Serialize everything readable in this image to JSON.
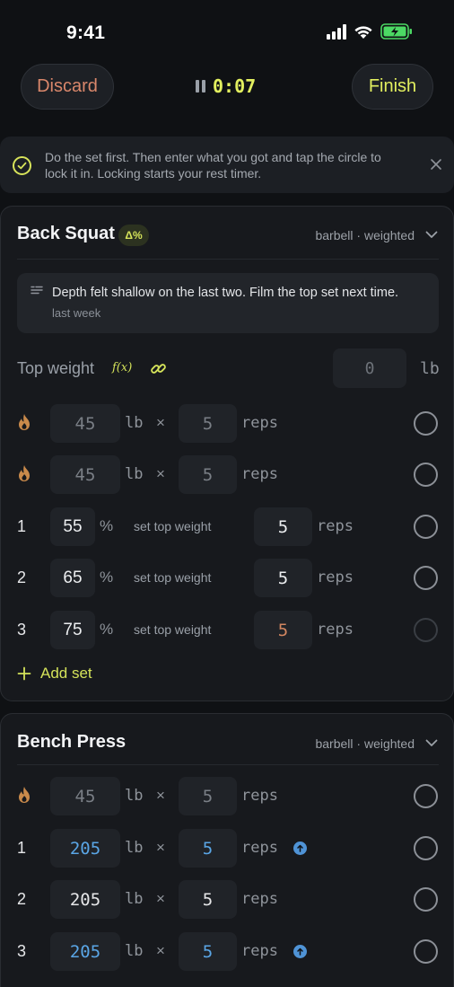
{
  "status_bar": {
    "time": "9:41"
  },
  "top_bar": {
    "discard_label": "Discard",
    "finish_label": "Finish",
    "timer": "0:07"
  },
  "hint": {
    "text": "Do the set first. Then enter what you got and tap the circle to lock it in. Locking starts your rest timer."
  },
  "exercises": [
    {
      "name": "Back Squat",
      "badge": "Δ%",
      "meta": "barbell · weighted",
      "note": {
        "text": "Depth felt shallow on the last two. Film the top set next time.",
        "time": "last week"
      },
      "top_weight": {
        "label": "Top weight",
        "formula_label": "f(x)",
        "value": "0",
        "unit": "lb"
      },
      "warmups": [
        {
          "weight": "45",
          "unit": "lb",
          "times": "×",
          "reps": "5",
          "reps_label": "reps"
        },
        {
          "weight": "45",
          "unit": "lb",
          "times": "×",
          "reps": "5",
          "reps_label": "reps"
        }
      ],
      "sets": [
        {
          "num": "1",
          "pct": "55",
          "pct_unit": "%",
          "hint": "set top weight",
          "reps": "5",
          "reps_label": "reps"
        },
        {
          "num": "2",
          "pct": "65",
          "pct_unit": "%",
          "hint": "set top weight",
          "reps": "5",
          "reps_label": "reps"
        },
        {
          "num": "3",
          "pct": "75",
          "pct_unit": "%",
          "hint": "set top weight",
          "reps": "5",
          "reps_label": "reps"
        }
      ],
      "add_set_label": "Add set"
    },
    {
      "name": "Bench Press",
      "meta": "barbell · weighted",
      "warmups": [
        {
          "weight": "45",
          "unit": "lb",
          "times": "×",
          "reps": "5",
          "reps_label": "reps"
        }
      ],
      "sets": [
        {
          "num": "1",
          "weight": "205",
          "unit": "lb",
          "times": "×",
          "reps": "5",
          "reps_label": "reps"
        },
        {
          "num": "2",
          "weight": "205",
          "unit": "lb",
          "times": "×",
          "reps": "5",
          "reps_label": "reps"
        },
        {
          "num": "3",
          "weight": "205",
          "unit": "lb",
          "times": "×",
          "reps": "5",
          "reps_label": "reps"
        }
      ]
    }
  ],
  "colors": {
    "accent": "#e2ef5f",
    "discard": "#d9876b",
    "blue": "#5aa6e6",
    "warmup": "#d18660"
  }
}
